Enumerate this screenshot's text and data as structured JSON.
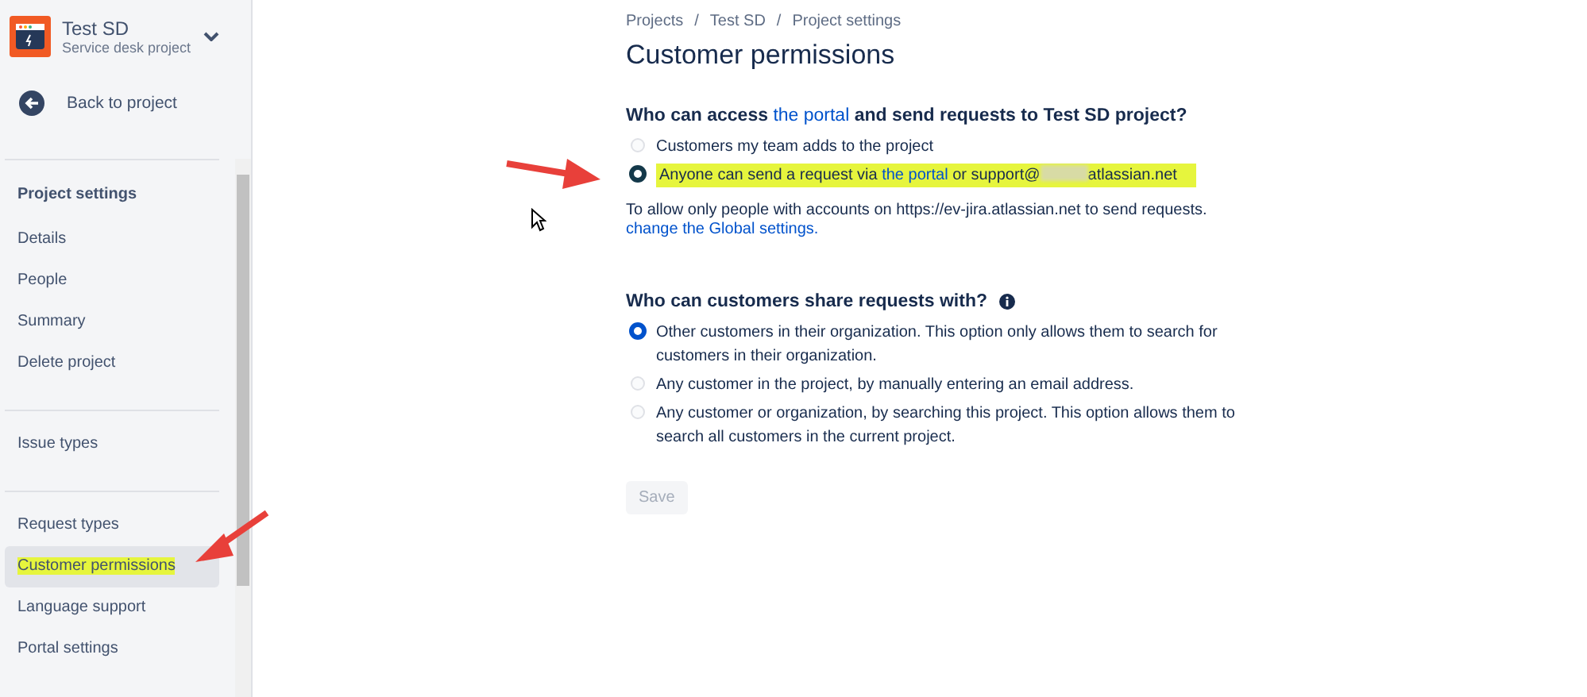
{
  "sidebar": {
    "project_name": "Test SD",
    "project_type": "Service desk project",
    "back_link": "Back to project",
    "groups": [
      {
        "heading": "Project settings",
        "items": [
          {
            "label": "Details",
            "selected": false,
            "highlighted": false
          },
          {
            "label": "People",
            "selected": false,
            "highlighted": false
          },
          {
            "label": "Summary",
            "selected": false,
            "highlighted": false
          },
          {
            "label": "Delete project",
            "selected": false,
            "highlighted": false
          }
        ]
      },
      {
        "items": [
          {
            "label": "Issue types",
            "selected": false,
            "highlighted": false
          }
        ]
      },
      {
        "items": [
          {
            "label": "Request types",
            "selected": false,
            "highlighted": false
          },
          {
            "label": "Customer permissions",
            "selected": true,
            "highlighted": true
          },
          {
            "label": "Language support",
            "selected": false,
            "highlighted": false
          },
          {
            "label": "Portal settings",
            "selected": false,
            "highlighted": false
          }
        ]
      }
    ]
  },
  "breadcrumbs": [
    "Projects",
    "Test SD",
    "Project settings"
  ],
  "breadcrumb_separator": "/",
  "title": "Customer permissions",
  "access": {
    "heading": [
      {
        "kind": "text",
        "text": "Who can access "
      },
      {
        "kind": "link",
        "text": "the portal"
      },
      {
        "kind": "text",
        "text": " and send requests to Test SD project?"
      }
    ],
    "options": [
      {
        "selected": false,
        "highlighted": false,
        "parts": [
          {
            "kind": "text",
            "text": "Customers my team adds to the project"
          }
        ]
      },
      {
        "selected": true,
        "highlighted": true,
        "parts": [
          {
            "kind": "text",
            "text": "Anyone can send a request via "
          },
          {
            "kind": "link",
            "text": "the portal"
          },
          {
            "kind": "text",
            "text": " or support@"
          },
          {
            "kind": "redacted"
          },
          {
            "kind": "text",
            "text": "atlassian.net"
          }
        ]
      }
    ],
    "note": "To allow only people with accounts on https://ev-jira.atlassian.net to send requests.",
    "note_link": "change the Global settings."
  },
  "sharing": {
    "heading": "Who can customers share requests with?",
    "options": [
      {
        "selected": true,
        "label": "Other customers in their organization. This option only allows them to search for customers in their organization."
      },
      {
        "selected": false,
        "label": "Any customer in the project, by manually entering an email address."
      },
      {
        "selected": false,
        "label": "Any customer or organization, by searching this project. This option allows them to search all customers in the current project."
      }
    ]
  },
  "save": {
    "label": "Save",
    "disabled": true
  }
}
